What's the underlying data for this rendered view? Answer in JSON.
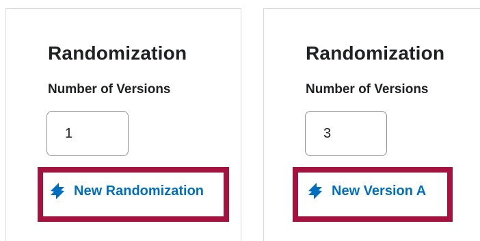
{
  "left_panel": {
    "section_title": "Randomization",
    "field_label": "Number of Versions",
    "versions_value": "1",
    "action_label": "New Randomization",
    "action_icon": "sync-icon"
  },
  "right_panel": {
    "section_title": "Randomization",
    "field_label": "Number of Versions",
    "versions_value": "3",
    "action_label": "New Version A",
    "action_icon": "sync-icon"
  },
  "colors": {
    "link": "#006fbf",
    "highlight": "#a4123f",
    "text": "#202122",
    "border": "#8e9298"
  }
}
